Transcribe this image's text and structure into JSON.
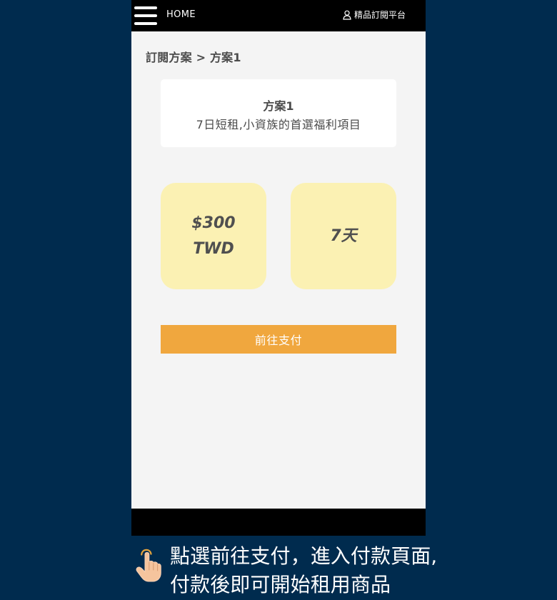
{
  "header": {
    "home_label": "HOME",
    "platform_label": "精品訂閱平台",
    "menu_icon": "hamburger-menu-icon",
    "user_icon": "user-icon"
  },
  "breadcrumb": {
    "text": "訂閱方案 > 方案1"
  },
  "plan": {
    "title": "方案1",
    "description": "7日短租,小資族的首選福利項目",
    "price_line1": "$300",
    "price_line2": "TWD",
    "duration": "7天"
  },
  "actions": {
    "pay_label": "前往支付"
  },
  "instruction": {
    "line1": "點選前往支付，進入付款頁面,",
    "line2": "付款後即可開始租用商品",
    "icon": "pointing-hand-icon"
  },
  "colors": {
    "background": "#002b4e",
    "phone_background": "#f4f4f4",
    "header_background": "#000000",
    "card_background": "#ffffff",
    "info_box_background": "#fbf1b3",
    "button_background": "#f0a73e",
    "text_primary": "#4b4b4b"
  }
}
